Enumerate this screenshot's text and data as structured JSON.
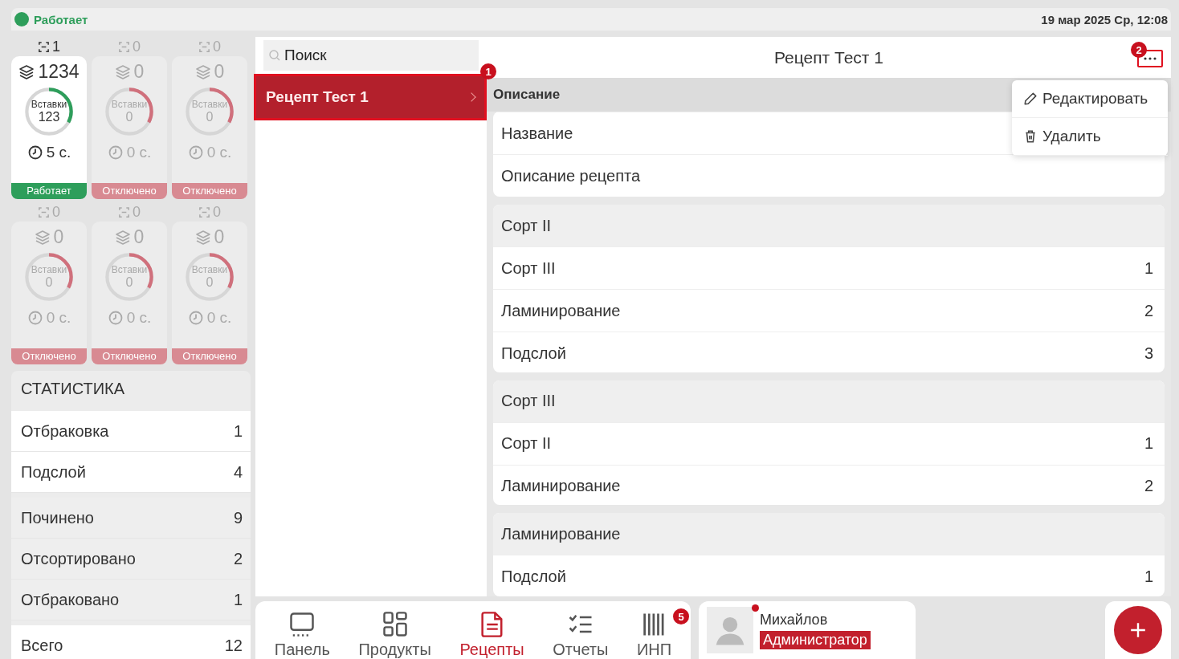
{
  "status_bar": {
    "state": "Работает",
    "running": true,
    "datetime": "19 мар 2025 Ср, 12:08"
  },
  "machines": [
    {
      "count": "1",
      "layers": "1234",
      "gauge_label": "Вставки",
      "gauge_value": "123",
      "level": 0.33,
      "time": "5 с.",
      "status": "Работает",
      "running": true
    },
    {
      "count": "0",
      "layers": "0",
      "gauge_label": "Вставки",
      "gauge_value": "0",
      "level": 0.33,
      "time": "0 с.",
      "status": "Отключено",
      "running": false
    },
    {
      "count": "0",
      "layers": "0",
      "gauge_label": "Вставки",
      "gauge_value": "0",
      "level": 0.33,
      "time": "0 с.",
      "status": "Отключено",
      "running": false
    },
    {
      "count": "0",
      "layers": "0",
      "gauge_label": "Вставки",
      "gauge_value": "0",
      "level": 0.33,
      "time": "0 с.",
      "status": "Отключено",
      "running": false
    },
    {
      "count": "0",
      "layers": "0",
      "gauge_label": "Вставки",
      "gauge_value": "0",
      "level": 0.33,
      "time": "0 с.",
      "status": "Отключено",
      "running": false
    },
    {
      "count": "0",
      "layers": "0",
      "gauge_label": "Вставки",
      "gauge_value": "0",
      "level": 0.33,
      "time": "0 с.",
      "status": "Отключено",
      "running": false
    }
  ],
  "statistics": {
    "title": "СТАТИСТИКА",
    "groups": [
      {
        "rows": [
          {
            "label": "Отбраковка",
            "value": "1"
          },
          {
            "label": "Подслой",
            "value": "4"
          }
        ]
      },
      {
        "rows": [
          {
            "label": "Починено",
            "value": "9"
          },
          {
            "label": "Отсортировано",
            "value": "2"
          },
          {
            "label": "Отбраковано",
            "value": "1"
          }
        ]
      },
      {
        "rows": [
          {
            "label": "Всего",
            "value": "12"
          }
        ]
      }
    ]
  },
  "recipes": {
    "search": {
      "placeholder": "Поиск"
    },
    "items": [
      {
        "name": "Рецепт Тест 1",
        "selected": true,
        "badge": "1"
      }
    ]
  },
  "detail": {
    "title": "Рецепт Тест 1",
    "more_badge": "2",
    "menu": [
      {
        "label": "Редактировать",
        "kind": "pencil"
      },
      {
        "label": "Удалить",
        "kind": "trash"
      }
    ],
    "sections": [
      {
        "kind": "description",
        "title": "Описание",
        "rows": [
          {
            "label": "Название"
          },
          {
            "label": "Описание рецепта"
          }
        ]
      },
      {
        "kind": "group",
        "title": "Сорт II",
        "rows": [
          {
            "label": "Сорт III",
            "value": "1"
          },
          {
            "label": "Ламинирование",
            "value": "2"
          },
          {
            "label": "Подслой",
            "value": "3"
          }
        ]
      },
      {
        "kind": "group",
        "title": "Сорт III",
        "rows": [
          {
            "label": "Сорт II",
            "value": "1"
          },
          {
            "label": "Ламинирование",
            "value": "2"
          }
        ]
      },
      {
        "kind": "group",
        "title": "Ламинирование",
        "rows": [
          {
            "label": "Подслой",
            "value": "1"
          }
        ]
      }
    ]
  },
  "nav": [
    {
      "label": "Панель",
      "kind": "monitor",
      "selected": false
    },
    {
      "label": "Продукты",
      "kind": "grid",
      "selected": false
    },
    {
      "label": "Рецепты",
      "kind": "document",
      "selected": true
    },
    {
      "label": "Отчеты",
      "kind": "checklist",
      "selected": false
    },
    {
      "label": "ИНП",
      "kind": "bars",
      "selected": false,
      "badge": "5"
    }
  ],
  "user": {
    "name": "Михайлов",
    "role": "Администратор",
    "online": true
  }
}
